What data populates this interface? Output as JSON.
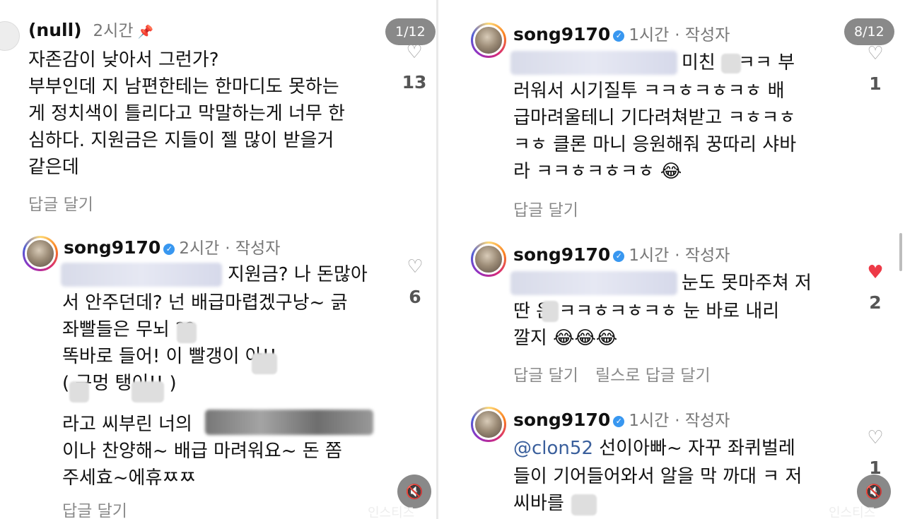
{
  "left_panel": {
    "counter": "1/12",
    "comment1": {
      "username": "(null)",
      "time": "2시간",
      "pin_icon": "pin-icon",
      "text": "자존감이 낮아서 그런가?\n부부인데 지 남편한테는 한마디도 못하는\n게 정치색이 틀리다고 막말하는게 너무 한\n심하다. 지원금은 지들이 젤 많이 받을거\n같은데",
      "reply": "답글 달기",
      "likes": "13"
    },
    "comment2": {
      "username": "song9170",
      "time": "2시간",
      "author_tag": "· 작성자",
      "line1": "지원금? 나 돈많아",
      "text_rest": "서 안주던데? 넌 배급마렵겠구낭~ 긁\n좌빨들은 무뇌  ??\n똑바로 들어! 이 빨갱이    아!!\n(    구멍      탱이!! )",
      "line_praise": "라고 씨부린 너의",
      "text_end": "이나 찬양해~ 배급 마려워요~ 돈 쫌\n주세효~에휴ㅉㅉ",
      "reply": "답글 달기",
      "likes": "6"
    },
    "watermark": "인스티즈"
  },
  "right_panel": {
    "counter": "8/12",
    "comment1": {
      "username": "song9170",
      "time": "1시간",
      "author_tag": "· 작성자",
      "line1": "미친     ㅋㅋㅋ 부",
      "text_rest": "러워서 시기질투 ㅋㅋㅎㅋㅎㅋㅎ 배\n급마려울테니 기다려쳐받고 ㅋㅎㅋㅎ\nㅋㅎ 클론 마니 응원해줘 꿍따리 샤바\n라 ㅋㅋㅎㅋㅎㅋㅎ 😂",
      "reply": "답글 달기",
      "likes": "1"
    },
    "comment2": {
      "username": "song9170",
      "time": "1시간",
      "author_tag": "· 작성자",
      "line1": "눈도 못마주쳐 저",
      "text_rest": "딴  은 ㅋㅋㅎㅋㅎㅋㅎ 눈 바로 내리\n깔지 😂😂😂",
      "reply": "답글 달기",
      "reply_reels": "릴스로 답글 달기",
      "likes": "2"
    },
    "comment3": {
      "username": "song9170",
      "time": "1시간",
      "author_tag": "· 작성자",
      "mention": "@clon52",
      "line1_rest": " 선이아빠~ 자꾸 좌퀴벌레",
      "text_rest": "들이 기어들어와서 알을 막 까대 ㅋ 저\n씨바를",
      "likes": "1"
    },
    "watermark": "인스티즈"
  },
  "colors": {
    "like_active": "#ed3a47",
    "verified": "#3897f0",
    "mention": "#3a5f9c"
  },
  "icons": {
    "heart": "heart-icon",
    "mute": "speaker-muted-icon",
    "verified": "verified-badge-icon"
  }
}
